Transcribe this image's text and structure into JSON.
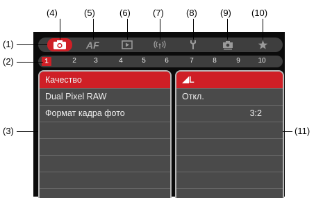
{
  "callouts": {
    "c1": "(1)",
    "c2": "(2)",
    "c3": "(3)",
    "c4": "(4)",
    "c5": "(5)",
    "c6": "(6)",
    "c7": "(7)",
    "c8": "(8)",
    "c9": "(9)",
    "c10": "(10)",
    "c11": "(11)"
  },
  "tabs": {
    "shooting": "camera-icon",
    "af": "AF",
    "playback": "play-icon",
    "wireless": "wireless-icon",
    "setup": "wrench-icon",
    "custom": "camera-custom-icon",
    "mymenu": "star-icon"
  },
  "pages": [
    "1",
    "2",
    "3",
    "4",
    "5",
    "6",
    "7",
    "8",
    "9",
    "10"
  ],
  "menu_items": [
    "Качество",
    "Dual Pixel RAW",
    "Формат кадра фото"
  ],
  "settings": [
    "L",
    "Откл.",
    "3:2"
  ],
  "colors": {
    "accent": "#cf1f26",
    "background": "#0b0b0b",
    "panel": "#4a4a4a"
  }
}
